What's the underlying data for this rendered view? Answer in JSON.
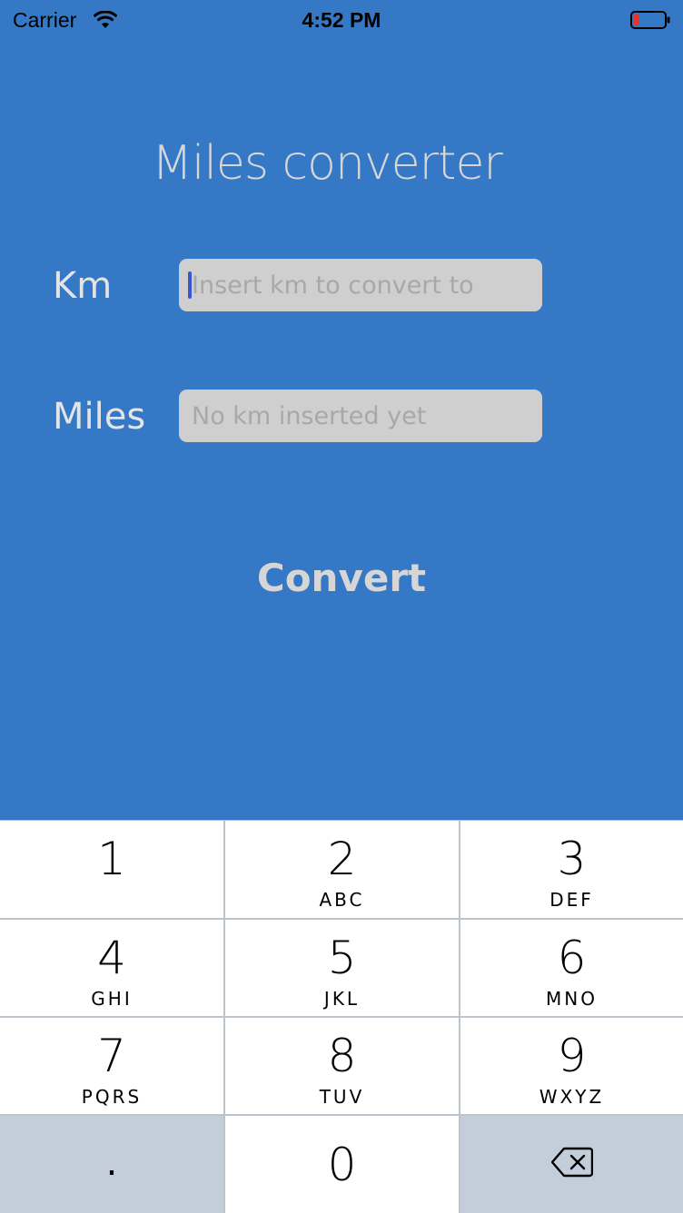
{
  "status_bar": {
    "carrier": "Carrier",
    "time": "4:52 PM",
    "wifi_icon": "wifi-icon",
    "battery_icon": "battery-low-icon",
    "battery_color": "#e8352a"
  },
  "app": {
    "background_color": "#3478c6",
    "title": "Miles converter",
    "km": {
      "label": "Km",
      "value": "",
      "placeholder": "Insert km to convert to"
    },
    "miles": {
      "label": "Miles",
      "value": "",
      "placeholder": "No km inserted yet"
    },
    "convert_label": "Convert"
  },
  "keypad": {
    "keys": [
      {
        "digit": "1",
        "letters": ""
      },
      {
        "digit": "2",
        "letters": "ABC"
      },
      {
        "digit": "3",
        "letters": "DEF"
      },
      {
        "digit": "4",
        "letters": "GHI"
      },
      {
        "digit": "5",
        "letters": "JKL"
      },
      {
        "digit": "6",
        "letters": "MNO"
      },
      {
        "digit": "7",
        "letters": "PQRS"
      },
      {
        "digit": "8",
        "letters": "TUV"
      },
      {
        "digit": "9",
        "letters": "WXYZ"
      }
    ],
    "decimal": ".",
    "zero": "0",
    "delete_icon": "backspace-icon"
  }
}
